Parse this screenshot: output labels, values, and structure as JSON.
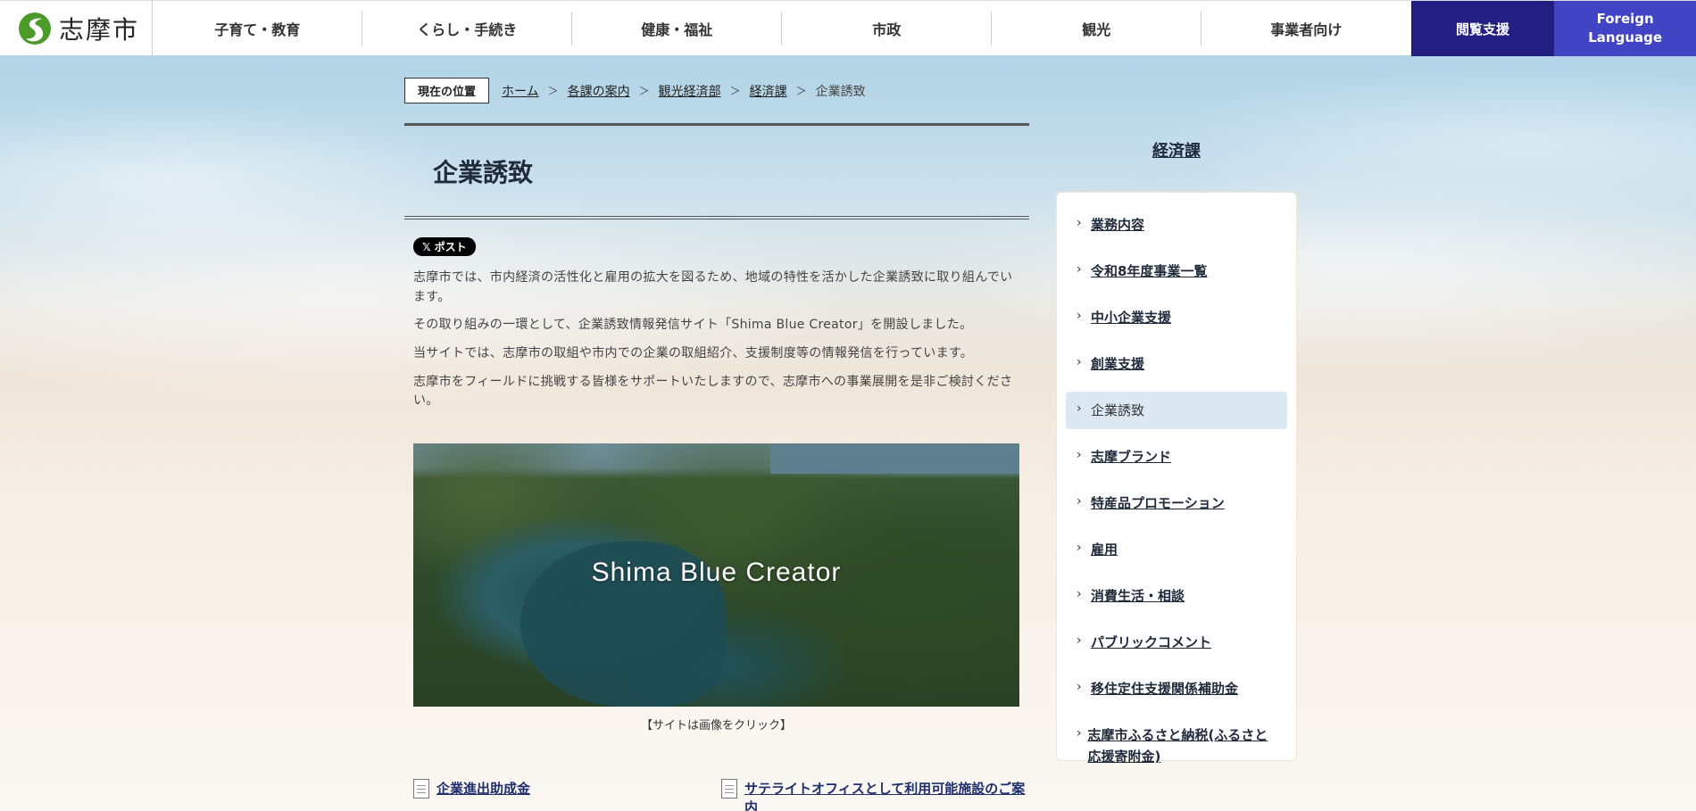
{
  "header": {
    "logo_text": "志摩市",
    "nav": [
      "子育て・教育",
      "くらし・手続き",
      "健康・福祉",
      "市政",
      "観光",
      "事業者向け"
    ],
    "access_button": "閲覧支援",
    "lang_button_line1": "Foreign",
    "lang_button_line2": "Language",
    "brand_color": "#231f82",
    "lang_color": "#4244c6"
  },
  "breadcrumb": {
    "label": "現在の位置",
    "items": [
      "ホーム",
      "各課の案内",
      "観光経済部",
      "経済課"
    ],
    "current": "企業誘致"
  },
  "main": {
    "title": "企業誘致",
    "x_post": "ポスト",
    "paragraphs": [
      "志摩市では、市内経済の活性化と雇用の拡大を図るため、地域の特性を活かした企業誘致に取り組んでいます。",
      "その取り組みの一環として、企業誘致情報発信サイト「Shima Blue Creator」を開設しました。",
      "当サイトでは、志摩市の取組や市内での企業の取組紹介、支援制度等の情報発信を行っています。",
      "志摩市をフィールドに挑戦する皆様をサポートいたしますので、志摩市への事業展開を是非ご検討ください。"
    ],
    "banner_text": "Shima Blue Creator",
    "caption": "【サイトは画像をクリック】",
    "files": [
      "企業進出助成金",
      "サテライトオフィスとして利用可能施設のご案内"
    ]
  },
  "sidebar": {
    "title": "経済課",
    "items": [
      "業務内容",
      "令和8年度事業一覧",
      "中小企業支援",
      "創業支援",
      "企業誘致",
      "志摩ブランド",
      "特産品プロモーション",
      "雇用",
      "消費生活・相談",
      "パブリックコメント",
      "移住定住支援関係補助金",
      "志摩市ふるさと納税(ふるさと応援寄附金)"
    ],
    "active_index": 4
  }
}
